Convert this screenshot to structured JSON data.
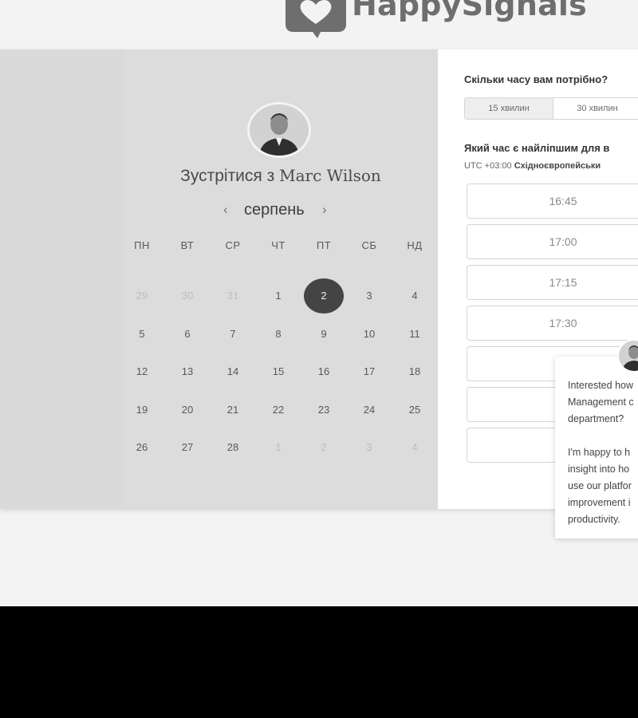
{
  "brand": {
    "logo_text": "HappySignals"
  },
  "host": {
    "title_prefix": "Зустрітися з",
    "name": "Marc Wilson"
  },
  "calendar": {
    "month": "серпень",
    "weekdays": [
      "ПН",
      "ВТ",
      "СР",
      "ЧТ",
      "ПТ",
      "СБ",
      "НД"
    ],
    "weeks": [
      [
        "29",
        "30",
        "31",
        "1",
        "2",
        "3",
        "4"
      ],
      [
        "5",
        "6",
        "7",
        "8",
        "9",
        "10",
        "11"
      ],
      [
        "12",
        "13",
        "14",
        "15",
        "16",
        "17",
        "18"
      ],
      [
        "19",
        "20",
        "21",
        "22",
        "23",
        "24",
        "25"
      ],
      [
        "26",
        "27",
        "28",
        "1",
        "2",
        "3",
        "4"
      ]
    ],
    "selected_day": "2"
  },
  "booking": {
    "duration_question": "Скільки часу вам потрібно?",
    "durations": [
      "15 хвилин",
      "30 хвилин"
    ],
    "active_duration": "15 хвилин",
    "time_question": "Який час є найліпшим для в",
    "timezone_offset": "UTC +03:00",
    "timezone_name": "Східноєвропейськи",
    "slots": [
      "16:45",
      "17:00",
      "17:15",
      "17:30",
      "",
      "",
      ""
    ]
  },
  "chat": {
    "message": "Interested how\nManagement c\ndepartment?\n\nI'm happy to h\ninsight into ho\nuse our platfor\nimprovement i\nproductivity."
  },
  "colors": {
    "selected_day": "#444444",
    "panel_left": "#dadada",
    "panel_right": "#ffffff"
  }
}
